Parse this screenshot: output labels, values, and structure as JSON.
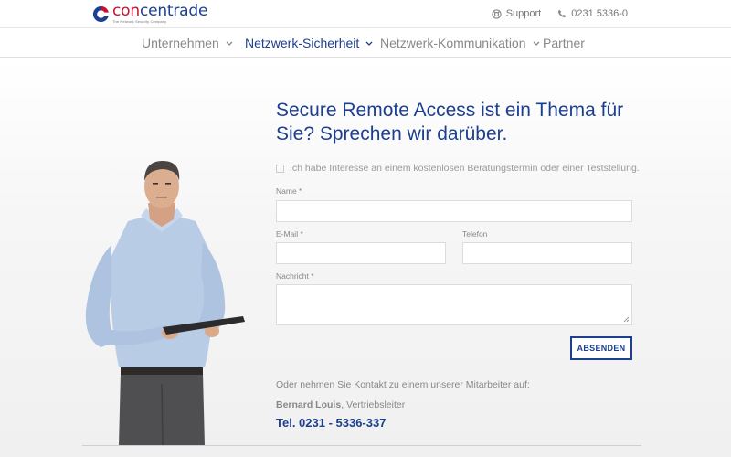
{
  "brand": {
    "name_part1": "con",
    "name_part2": "centrade",
    "tagline": "The Network Security Company"
  },
  "util": {
    "support_label": "Support",
    "phone_label": "0231 5336-0"
  },
  "nav": {
    "items": [
      {
        "label": "Unternehmen",
        "has_dropdown": true,
        "active": false
      },
      {
        "label": "Netzwerk-Sicherheit",
        "has_dropdown": true,
        "active": true
      },
      {
        "label": "Netzwerk-Kommunikation",
        "has_dropdown": true,
        "active": false
      },
      {
        "label": "Partner",
        "has_dropdown": false,
        "active": false
      }
    ]
  },
  "form": {
    "headline": "Secure Remote Access ist ein Thema für Sie? Sprechen wir darüber.",
    "consent_label": "Ich habe Interesse an einem kostenlosen Beratungstermin oder einer Teststellung.",
    "name_label": "Name *",
    "email_label": "E-Mail *",
    "phone_label": "Telefon",
    "message_label": "Nachricht *",
    "submit_label": "ABSENDEN"
  },
  "contact": {
    "intro": "Oder nehmen Sie Kontakt zu einem unserer Mitarbeiter auf:",
    "name": "Bernard Louis",
    "role": ", Vertriebsleiter",
    "phone": "Tel. 0231 - 5336-337"
  },
  "colors": {
    "brand_blue": "#1d3f8f",
    "brand_red": "#c8102e"
  }
}
